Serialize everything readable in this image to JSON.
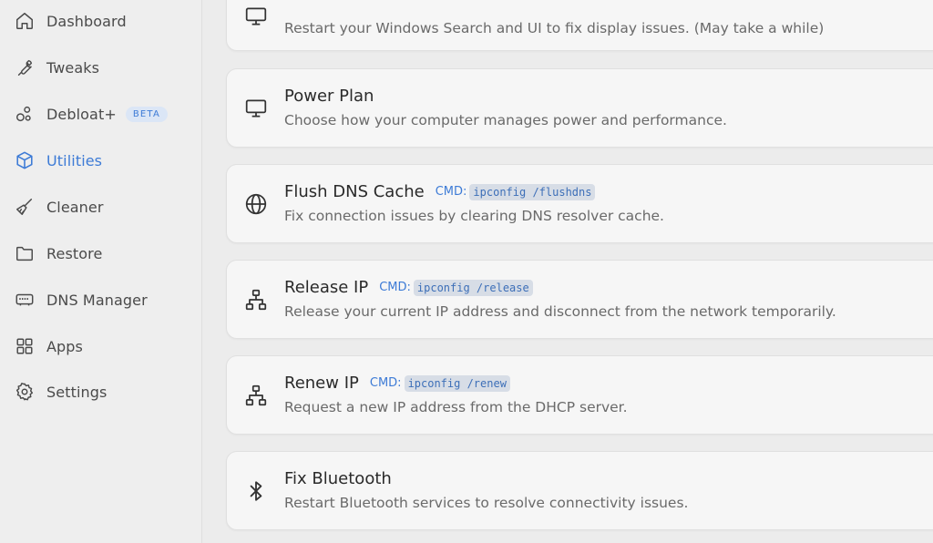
{
  "sidebar": {
    "items": [
      {
        "label": "Dashboard",
        "icon": "home-icon"
      },
      {
        "label": "Tweaks",
        "icon": "wrench-icon"
      },
      {
        "label": "Debloat+",
        "icon": "bubbles-icon",
        "badge": "BETA"
      },
      {
        "label": "Utilities",
        "icon": "cube-icon",
        "active": true
      },
      {
        "label": "Cleaner",
        "icon": "broom-icon"
      },
      {
        "label": "Restore",
        "icon": "folder-icon"
      },
      {
        "label": "DNS Manager",
        "icon": "router-icon"
      },
      {
        "label": "Apps",
        "icon": "grid-icon"
      },
      {
        "label": "Settings",
        "icon": "gear-icon"
      }
    ]
  },
  "cards": [
    {
      "title": "",
      "desc": "Restart your Windows Search and UI to fix display issues. (May take a while)",
      "icon": "monitor-icon"
    },
    {
      "title": "Power Plan",
      "desc": "Choose how your computer manages power and performance.",
      "icon": "monitor-icon"
    },
    {
      "title": "Flush DNS Cache",
      "cmd_label": "CMD:",
      "cmd": "ipconfig /flushdns",
      "desc": "Fix connection issues by clearing DNS resolver cache.",
      "icon": "globe-icon"
    },
    {
      "title": "Release IP",
      "cmd_label": "CMD:",
      "cmd": "ipconfig /release",
      "desc": "Release your current IP address and disconnect from the network temporarily.",
      "icon": "network-icon"
    },
    {
      "title": "Renew IP",
      "cmd_label": "CMD:",
      "cmd": "ipconfig /renew",
      "desc": "Request a new IP address from the DHCP server.",
      "icon": "network-icon"
    },
    {
      "title": "Fix Bluetooth",
      "desc": "Restart Bluetooth services to resolve connectivity issues.",
      "icon": "bluetooth-icon"
    }
  ],
  "colors": {
    "accent": "#3d7bd6",
    "text": "#2a2a2a",
    "muted": "#6a6a6a"
  }
}
